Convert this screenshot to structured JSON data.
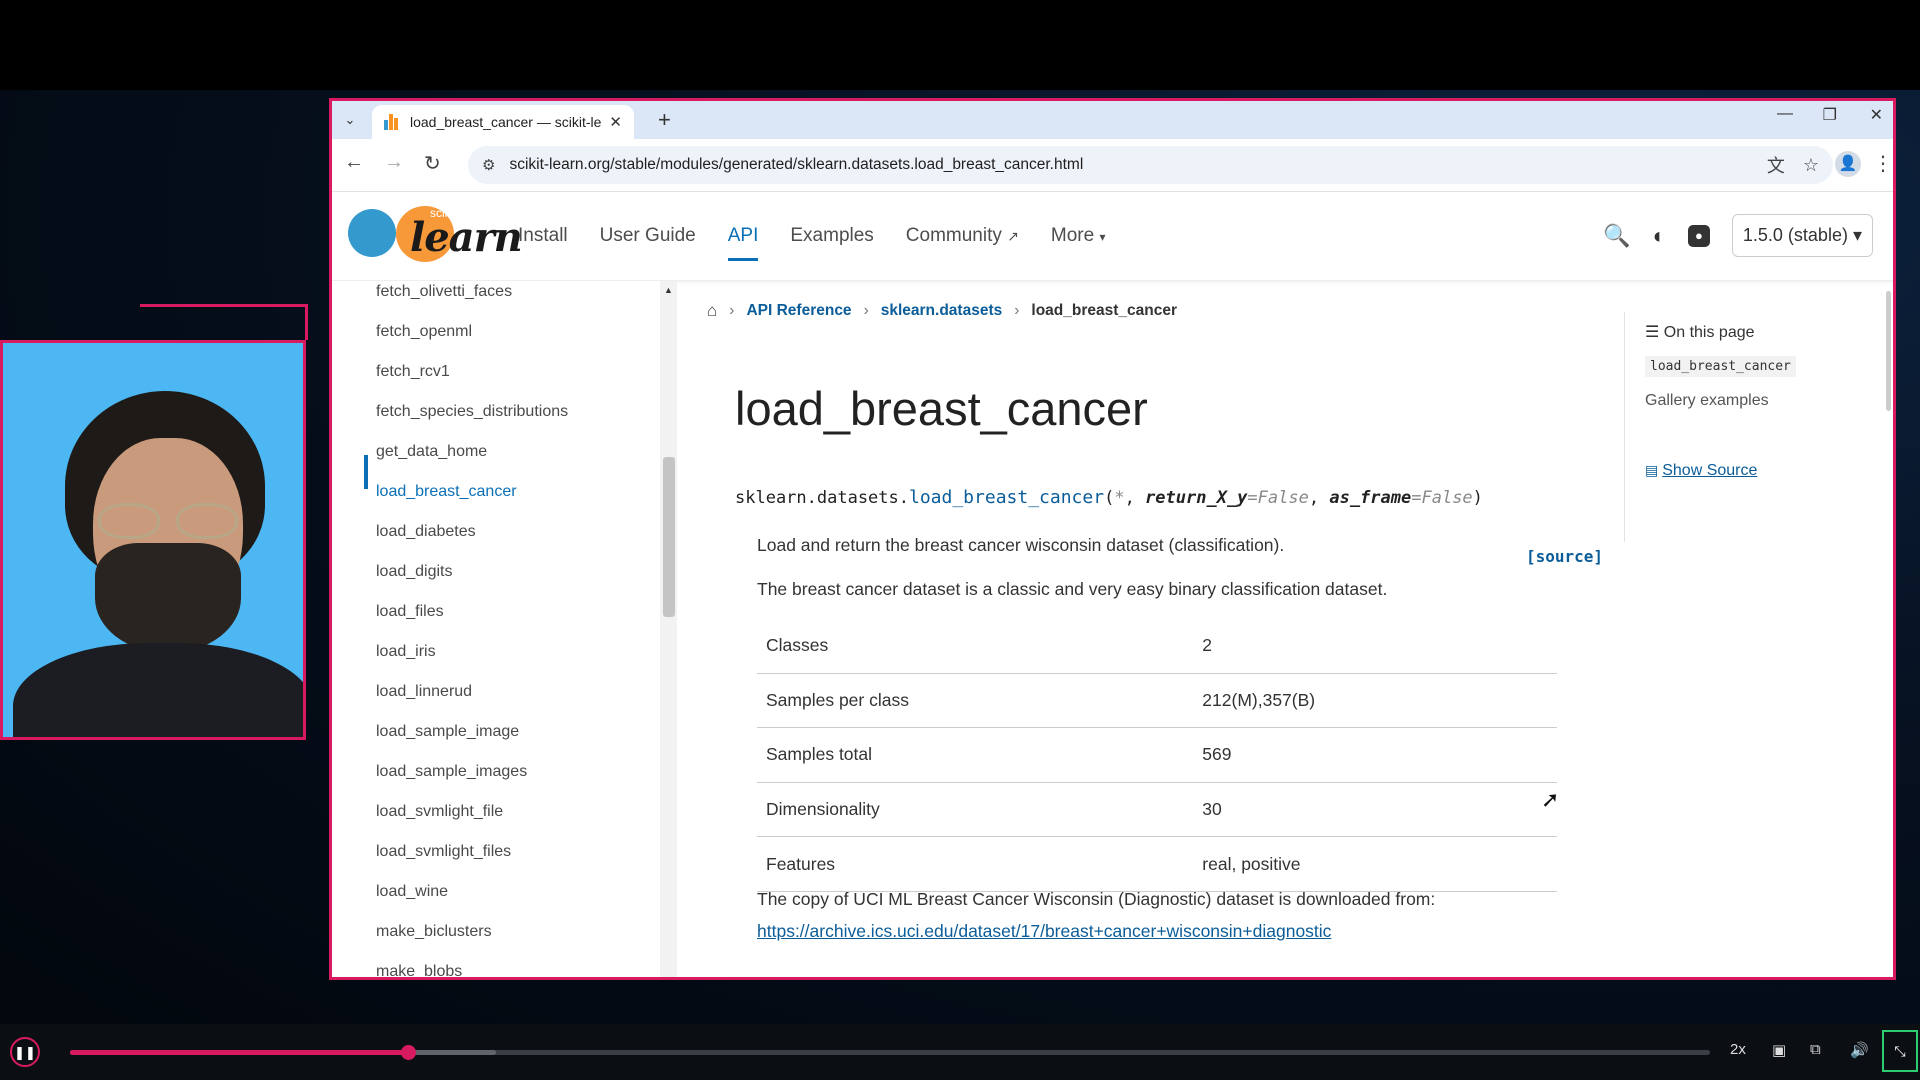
{
  "browser": {
    "tab_title": "load_breast_cancer — scikit-lea",
    "url": "scikit-learn.org/stable/modules/generated/sklearn.datasets.load_breast_cancer.html"
  },
  "site": {
    "logo_small": "scikit",
    "logo_big": "learn",
    "nav": [
      "Install",
      "User Guide",
      "API",
      "Examples",
      "Community",
      "More"
    ],
    "active_nav": "API",
    "version": "1.5.0 (stable)"
  },
  "sidebar": {
    "items": [
      "fetch_olivetti_faces",
      "fetch_openml",
      "fetch_rcv1",
      "fetch_species_distributions",
      "get_data_home",
      "load_breast_cancer",
      "load_diabetes",
      "load_digits",
      "load_files",
      "load_iris",
      "load_linnerud",
      "load_sample_image",
      "load_sample_images",
      "load_svmlight_file",
      "load_svmlight_files",
      "load_wine",
      "make_biclusters",
      "make_blobs"
    ],
    "active_index": 5
  },
  "breadcrumb": {
    "api_reference": "API Reference",
    "module": "sklearn.datasets",
    "current": "load_breast_cancer"
  },
  "main": {
    "title": "load_breast_cancer",
    "sig_module": "sklearn.datasets.",
    "sig_func": "load_breast_cancer",
    "sig_open": "(",
    "sig_star": "*",
    "sig_sep": ", ",
    "sig_p1": "return_X_y",
    "sig_eq": "=",
    "sig_d1": "False",
    "sig_p2": "as_frame",
    "sig_d2": "False",
    "sig_close": ")",
    "source_link": "[source]",
    "desc1": "Load and return the breast cancer wisconsin dataset (classification).",
    "desc2": "The breast cancer dataset is a classic and very easy binary classification dataset.",
    "table": [
      {
        "label": "Classes",
        "value": "2"
      },
      {
        "label": "Samples per class",
        "value": "212(M),357(B)"
      },
      {
        "label": "Samples total",
        "value": "569"
      },
      {
        "label": "Dimensionality",
        "value": "30"
      },
      {
        "label": "Features",
        "value": "real, positive"
      }
    ],
    "copy_text": "The copy of UCI ML Breast Cancer Wisconsin (Diagnostic) dataset is downloaded from:",
    "copy_link": "https://archive.ics.uci.edu/dataset/17/breast+cancer+wisconsin+diagnostic"
  },
  "toc": {
    "heading": "On this page",
    "item1": "load_breast_cancer",
    "item2": "Gallery examples",
    "show_source": "Show Source"
  },
  "player": {
    "speed": "2x",
    "progress_fraction": 0.206,
    "buffered_fraction": 0.26
  },
  "colors": {
    "accent": "#d81b60",
    "link": "#0b5d99",
    "nav_active": "#0b6fb6",
    "webcam_bg": "#4cb7f2"
  }
}
